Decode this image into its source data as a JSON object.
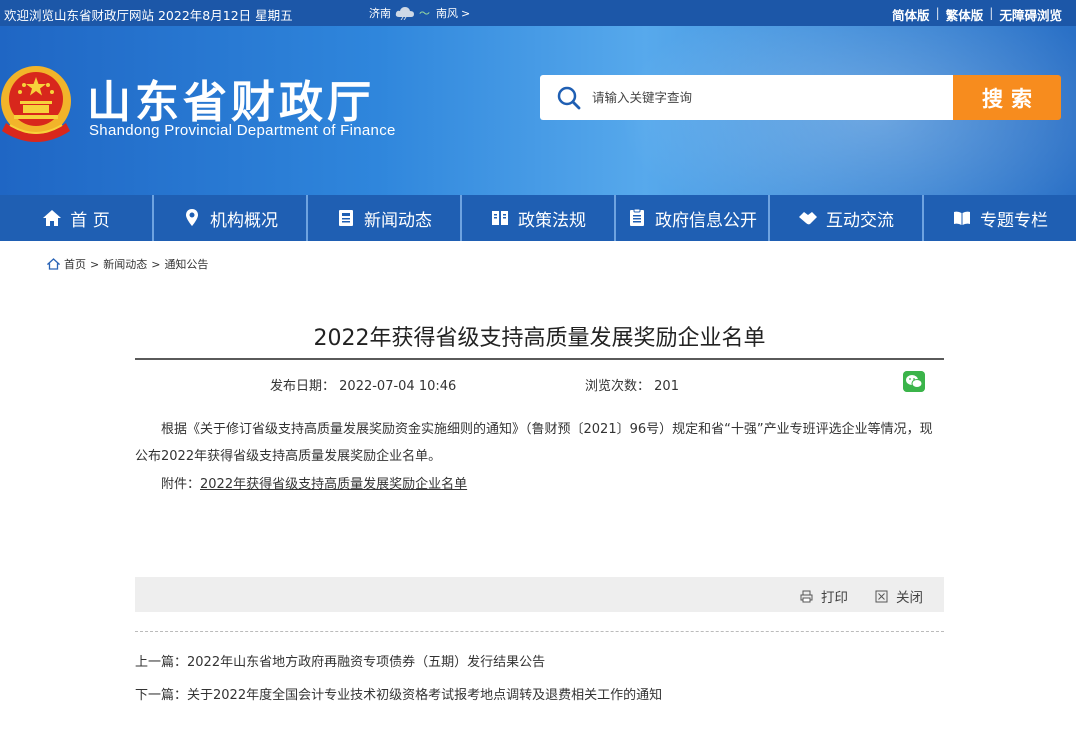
{
  "topbar": {
    "welcome": "欢迎浏览山东省财政厅网站  2022年8月12日 星期五",
    "weather": {
      "city": "济南",
      "temp_low": "〜",
      "temp_high": "",
      "wind": "南风",
      "arrow": ">"
    },
    "lang": {
      "simplified": "简体版",
      "traditional": "繁体版",
      "accessible": "无障碍浏览",
      "sep": "|"
    }
  },
  "header": {
    "title": "山东省财政厅",
    "subtitle": "Shandong Provincial Department of Finance",
    "search_placeholder": "请输入关键字查询",
    "search_button": "搜索"
  },
  "nav": [
    {
      "label": "首 页",
      "icon": "home-icon"
    },
    {
      "label": "机构概况",
      "icon": "location-pin-icon"
    },
    {
      "label": "新闻动态",
      "icon": "news-icon"
    },
    {
      "label": "政策法规",
      "icon": "book-icon"
    },
    {
      "label": "政府信息公开",
      "icon": "document-icon"
    },
    {
      "label": "互动交流",
      "icon": "handshake-icon"
    },
    {
      "label": "专题专栏",
      "icon": "open-book-icon"
    }
  ],
  "breadcrumb": {
    "home": "首页",
    "sep": ">",
    "level1": "新闻动态",
    "level2": "通知公告"
  },
  "article": {
    "title": "2022年获得省级支持高质量发展奖励企业名单",
    "date_label": "发布日期：",
    "date": "2022-07-04 10:46",
    "views_label": "浏览次数：",
    "views": "201",
    "paragraph": "根据《关于修订省级支持高质量发展奖励资金实施细则的通知》（鲁财预〔2021〕96号）规定和省“十强”产业专班评选企业等情况，现公布2022年获得省级支持高质量发展奖励企业名单。",
    "attachment_label": "附件：",
    "attachment_link": "2022年获得省级支持高质量发展奖励企业名单",
    "print": "打印",
    "close": "关闭"
  },
  "prevnext": {
    "prev_label": "上一篇：",
    "prev_title": "2022年山东省地方政府再融资专项债券（五期）发行结果公告",
    "next_label": "下一篇：",
    "next_title": "关于2022年度全国会计专业技术初级资格考试报考地点调转及退费相关工作的通知"
  },
  "colors": {
    "topbar": "#1c57a8",
    "nav": "#1f5fb3",
    "search_button": "#f78c1e",
    "wechat": "#3bb44a"
  }
}
